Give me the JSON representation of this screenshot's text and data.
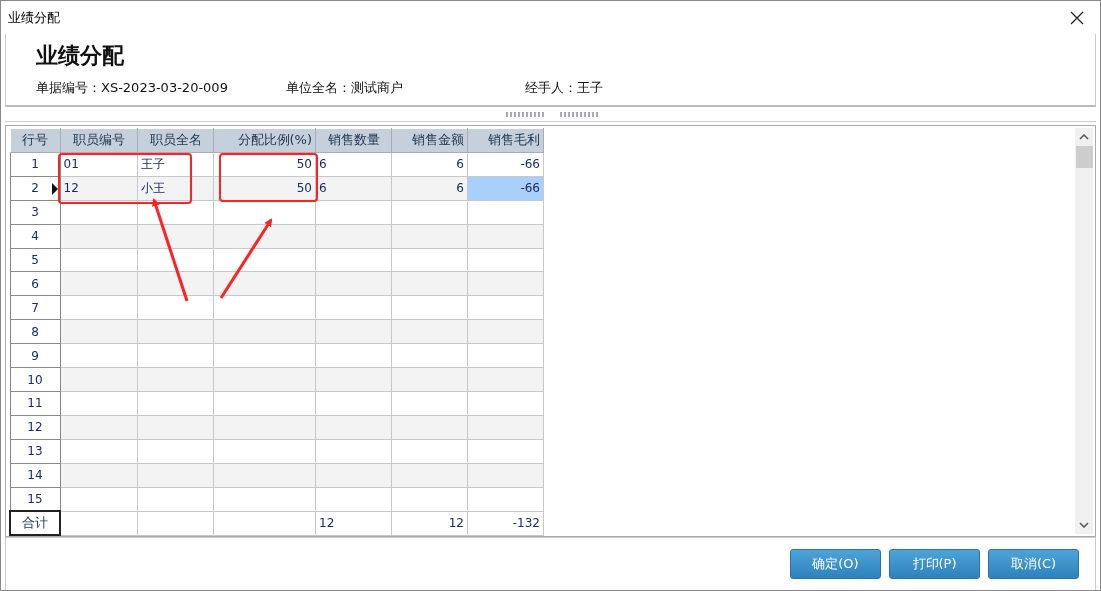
{
  "window": {
    "title": "业绩分配"
  },
  "header": {
    "title": "业绩分配",
    "fields": [
      {
        "label": "单据编号：",
        "value": "XS-2023-03-20-009"
      },
      {
        "label": "单位全名：",
        "value": "测试商户"
      },
      {
        "label": "经手人：",
        "value": "王子"
      }
    ]
  },
  "table": {
    "columns": [
      "行号",
      "职员编号",
      "职员全名",
      "分配比例(%)",
      "销售数量",
      "销售金额",
      "销售毛利"
    ],
    "rows": [
      {
        "cells": [
          "1",
          "01",
          "王子",
          "50",
          "6",
          "6",
          "-66"
        ],
        "selected": false
      },
      {
        "cells": [
          "2",
          "12",
          "小王",
          "50",
          "6",
          "6",
          "-66"
        ],
        "selected": true
      },
      {
        "cells": [
          "3",
          null,
          null,
          null,
          null,
          null,
          null
        ],
        "selected": false
      },
      {
        "cells": [
          "4",
          null,
          null,
          null,
          null,
          null,
          null
        ],
        "selected": false
      },
      {
        "cells": [
          "5",
          null,
          null,
          null,
          null,
          null,
          null
        ],
        "selected": false
      },
      {
        "cells": [
          "6",
          null,
          null,
          null,
          null,
          null,
          null
        ],
        "selected": false
      },
      {
        "cells": [
          "7",
          null,
          null,
          null,
          null,
          null,
          null
        ],
        "selected": false
      },
      {
        "cells": [
          "8",
          null,
          null,
          null,
          null,
          null,
          null
        ],
        "selected": false
      },
      {
        "cells": [
          "9",
          null,
          null,
          null,
          null,
          null,
          null
        ],
        "selected": false
      },
      {
        "cells": [
          "10",
          null,
          null,
          null,
          null,
          null,
          null
        ],
        "selected": false
      },
      {
        "cells": [
          "11",
          null,
          null,
          null,
          null,
          null,
          null
        ],
        "selected": false
      },
      {
        "cells": [
          "12",
          null,
          null,
          null,
          null,
          null,
          null
        ],
        "selected": false
      },
      {
        "cells": [
          "13",
          null,
          null,
          null,
          null,
          null,
          null
        ],
        "selected": false
      },
      {
        "cells": [
          "14",
          null,
          null,
          null,
          null,
          null,
          null
        ],
        "selected": false
      },
      {
        "cells": [
          "15",
          null,
          null,
          null,
          null,
          null,
          null
        ],
        "selected": false
      }
    ],
    "total": {
      "label": "合计",
      "sales_quantity": "12",
      "sales_amount": "12",
      "gross_profit": "-132"
    }
  },
  "buttons": [
    "确定(O)",
    "打印(P)",
    "取消(C)"
  ]
}
